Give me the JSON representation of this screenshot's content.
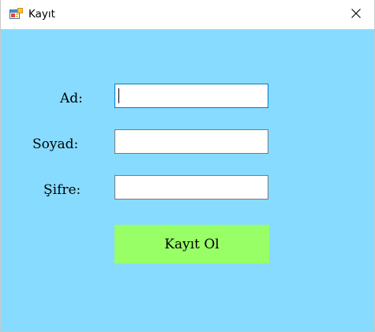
{
  "window": {
    "title": "Kayıt",
    "icon": "windows-form-icon",
    "close_icon": "close-icon"
  },
  "form": {
    "background_color": "#87dbff",
    "fields": [
      {
        "label": "Ad:",
        "value": "",
        "focused": true
      },
      {
        "label": "Soyad:",
        "value": "",
        "focused": false
      },
      {
        "label": "Şifre:",
        "value": "",
        "focused": false
      }
    ],
    "submit_label": "Kayıt Ol",
    "submit_color": "#99ff66"
  }
}
